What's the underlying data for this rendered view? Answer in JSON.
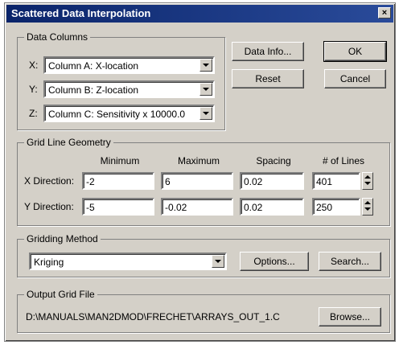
{
  "window": {
    "title": "Scattered Data Interpolation",
    "close_glyph": "×"
  },
  "data_columns": {
    "legend": "Data Columns",
    "x": {
      "label": "X:",
      "value": "Column A:  X-location"
    },
    "y": {
      "label": "Y:",
      "value": "Column B:  Z-location"
    },
    "z": {
      "label": "Z:",
      "value": "Column C:  Sensitivity x 10000.0"
    }
  },
  "buttons": {
    "data_info": "Data Info...",
    "ok": "OK",
    "reset": "Reset",
    "cancel": "Cancel",
    "options": "Options...",
    "search": "Search...",
    "browse": "Browse..."
  },
  "grid_line_geometry": {
    "legend": "Grid Line Geometry",
    "headers": {
      "minimum": "Minimum",
      "maximum": "Maximum",
      "spacing": "Spacing",
      "lines": "# of Lines"
    },
    "x": {
      "label": "X Direction:",
      "minimum": "-2",
      "maximum": "6",
      "spacing": "0.02",
      "lines": "401"
    },
    "y": {
      "label": "Y Direction:",
      "minimum": "-5",
      "maximum": "-0.02",
      "spacing": "0.02",
      "lines": "250"
    }
  },
  "gridding_method": {
    "legend": "Gridding Method",
    "value": "Kriging"
  },
  "output_grid_file": {
    "legend": "Output Grid File",
    "path": "D:\\MANUALS\\MAN2DMOD\\FRECHET\\ARRAYS_OUT_1.C"
  }
}
